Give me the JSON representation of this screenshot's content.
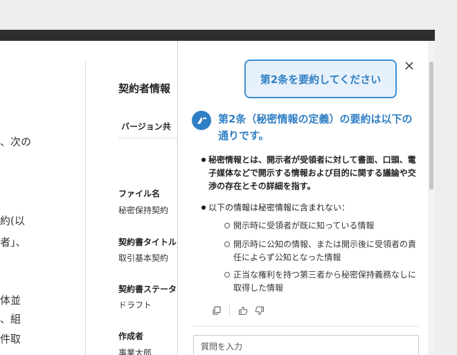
{
  "document": {
    "lines": [
      "、次の",
      "約(以",
      "者」、",
      "体並",
      "、組",
      "件取"
    ]
  },
  "info": {
    "title": "契約者情報",
    "version_tab": "バージョン共",
    "fields": [
      {
        "label": "ファイル名",
        "value": "秘密保持契約"
      },
      {
        "label": "契約書タイトル",
        "value": "取引基本契約"
      },
      {
        "label": "契約書ステータ",
        "value": "ドラフト"
      },
      {
        "label": "作成者",
        "value": "事業太郎"
      }
    ]
  },
  "assistant": {
    "user_message": "第2条を要約してください",
    "answer_heading": "第2条（秘密情報の定義）の要約は以下の通りです。",
    "bullets": [
      {
        "text": "秘密情報とは、開示者が受領者に対して書面、口頭、電子媒体などで開示する情報および目的に関する議論や交渉の存在とその詳細を指す。",
        "bold": true
      },
      {
        "text": "以下の情報は秘密情報に含まれない：",
        "bold": false
      }
    ],
    "sub_bullets": [
      "開示時に受領者が既に知っている情報",
      "開示時に公知の情報、または開示後に受領者の責任によらず公知となった情報",
      "正当な権利を持つ第三者から秘密保持義務なしに取得した情報"
    ],
    "question_placeholder": "質問を入力",
    "icons": {
      "close": "close-icon",
      "copy": "copy-icon",
      "thumbs_up": "thumbs-up-icon",
      "thumbs_down": "thumbs-down-icon",
      "avatar": "assistant-avatar-icon"
    }
  },
  "colors": {
    "accent": "#2f7fc4",
    "bubble_bg": "#e7f1fb",
    "topbar": "#2e2e2e"
  }
}
